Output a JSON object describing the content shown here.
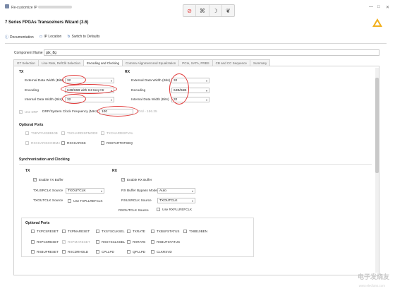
{
  "window": {
    "title": "Re-customize IP",
    "minimize": "—",
    "maximize": "□",
    "close": "✕"
  },
  "toolbar_icons": [
    "ie-icon",
    "puzzle-icon",
    "moon-icon",
    "cat-icon"
  ],
  "wizard": {
    "title": "7 Series FPGAs Transceivers Wizard (3.6)"
  },
  "actions": {
    "documentation": "Documentation",
    "ip_location": "IP Location",
    "switch_defaults": "Switch to Defaults"
  },
  "component": {
    "label": "Component Name",
    "value": "gtx_8g"
  },
  "tabs": [
    "GT Selection",
    "Line Rate, RefClk Selection",
    "Encoding and Clocking",
    "Comma Alignment and Equalization",
    "PCIe, SATA, PRBS",
    "CB and CC Sequence",
    "Summary"
  ],
  "active_tab": 2,
  "tx": {
    "head": "TX",
    "ext_width_label": "External Data Width (Bits)",
    "ext_width": "32",
    "encoding_label": "Encoding",
    "encoding": "64B/66B with Int Seq Ctr",
    "int_width_label": "Internal Data Width (Bits)",
    "int_width": "32"
  },
  "rx": {
    "head": "RX",
    "ext_width_label": "External Data Width (Bits)",
    "ext_width": "32",
    "decoding_label": "Decoding",
    "decoding": "64B/66B",
    "int_width_label": "Internal Data Width (Bits)",
    "int_width": "32"
  },
  "drp": {
    "use_label": "Use DRP",
    "freq_label": "DRP/System Clock Frequency (MHz)",
    "freq": "100",
    "range": "Drd - 156.25"
  },
  "optional_ports_1": {
    "head": "Optional Ports",
    "items": [
      "TXBYPASS8B10B",
      "TXCHARDISPMODE",
      "TXCHARDISPVAL",
      "RXCHARISCOMMA",
      "RXCHARISK",
      "RXSTARTOFSEQ"
    ]
  },
  "sync": {
    "head": "Synchronization and Clocking",
    "tx_head": "TX",
    "rx_head": "RX",
    "enable_tx_buffer": "Enable TX Buffer",
    "txusrclk_label": "TXUSRCLK Source",
    "txusrclk": "TXOUTCLK",
    "txoutclk_label": "TXOUTCLK Source",
    "use_txpll": "Use TXPLLREFCLK",
    "enable_rx_buffer": "Enable RX Buffer",
    "rxbypass_label": "RX Buffer Bypass Mode",
    "rxbypass": "Auto",
    "rxusrclk_label": "RXUSRCLK Source",
    "rxusrclk": "TXOUTCLK",
    "rxoutclk_label": "RXOUTCLK Source",
    "use_rxpll": "Use RXPLLREFCLK"
  },
  "optional_ports_2": {
    "head": "Optional Ports",
    "row1": [
      "TXPCSRESET",
      "TXPMARESET",
      "TXSYSCLKSEL",
      "TXRATE",
      "TXBUFSTATUS",
      "TX8B10BEN"
    ],
    "row2": [
      "RXPCSRESET",
      "RXPMARESET",
      "RXSYSCLKSEL",
      "RXRATE",
      "RXBUFSTATUS"
    ],
    "row3": [
      "RXBUFRESET",
      "RXCDRHOLD",
      "CPLLPD",
      "QPLLPD",
      "CLKRSVD"
    ]
  },
  "watermark": {
    "text": "电子发烧友",
    "sub": "www.elecfans.com"
  },
  "annotation_color": "#e23a3a"
}
